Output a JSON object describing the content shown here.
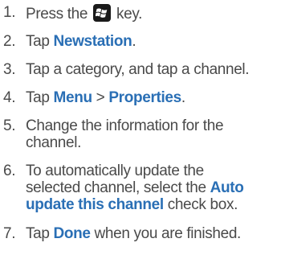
{
  "steps": [
    {
      "number": "1.",
      "pre": "Press the ",
      "icon": "windows-start-key-icon",
      "post": " key."
    },
    {
      "number": "2.",
      "pre": "Tap ",
      "kw1": "Newstation",
      "post": "."
    },
    {
      "number": "3.",
      "text": "Tap a category, and tap a channel."
    },
    {
      "number": "4.",
      "pre": "Tap ",
      "kw1": "Menu",
      "mid": " > ",
      "kw2": "Properties",
      "post": "."
    },
    {
      "number": "5.",
      "line1": "Change the information for the",
      "line2": "channel."
    },
    {
      "number": "6.",
      "line1": "To automatically update the",
      "line2_pre": "selected channel, select the ",
      "kw1": "Auto",
      "kw2": "update this channel",
      "line3_post": " check box."
    },
    {
      "number": "7.",
      "pre": "Tap ",
      "kw1": "Done",
      "post": " when you are finished."
    }
  ],
  "colors": {
    "text": "#4a4a4a",
    "keyword": "#2a6fb5"
  }
}
